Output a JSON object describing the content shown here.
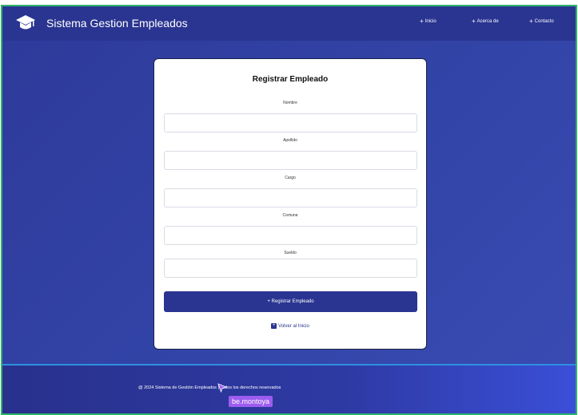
{
  "app": {
    "title": "Sistema Gestion Empleados"
  },
  "nav": {
    "items": [
      {
        "label": "Inicio"
      },
      {
        "label": "Acerca de"
      },
      {
        "label": "Contacto"
      }
    ]
  },
  "form": {
    "title": "Registrar Empleado",
    "fields": [
      {
        "label": "Nombre",
        "value": "",
        "placeholder": ""
      },
      {
        "label": "Apellido",
        "value": "",
        "placeholder": ""
      },
      {
        "label": "Cargo",
        "value": "",
        "placeholder": ""
      },
      {
        "label": "Comuna",
        "value": "",
        "placeholder": ""
      },
      {
        "label": "Sueldo",
        "value": "",
        "placeholder": ""
      }
    ],
    "submit_label": "+ Registrar Empleado",
    "back_label": "Volver al Inicio"
  },
  "footer": {
    "text": "@ 2024 Sistema de Gestión Empleados | Todos los derechos reservados"
  },
  "cursor_tag": {
    "label": "be.montoya"
  },
  "colors": {
    "primary": "#2a3591",
    "background": "#3243a6",
    "card": "#ffffff",
    "cursor_tag": "#9d5cf0",
    "frame_border": "#2fb36b"
  },
  "icons": {
    "brand": "graduation-cap-icon",
    "nav": "plus-icon",
    "back": "plus-square-icon",
    "cursor": "pointer-cursor-icon"
  }
}
